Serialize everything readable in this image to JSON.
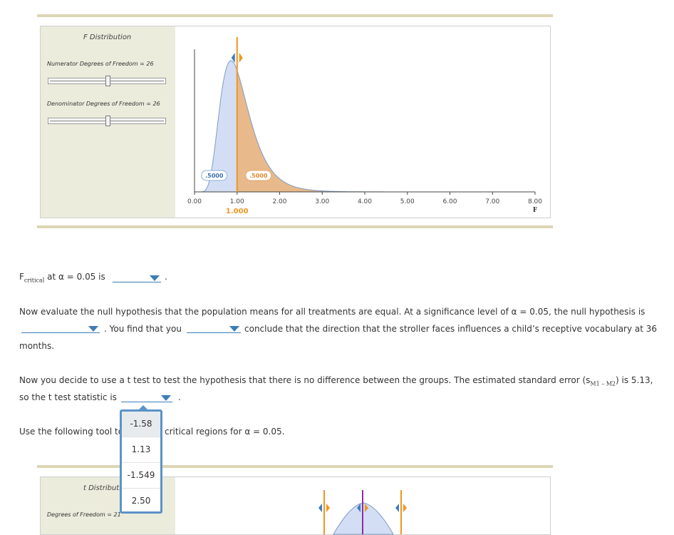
{
  "f_panel": {
    "title": "F Distribution",
    "numerator_label": "Numerator Degrees of Freedom = 26",
    "numerator_value": 26,
    "denominator_label": "Denominator Degrees of Freedom = 26",
    "denominator_value": 26,
    "slider_fraction_numerator": 0.5,
    "slider_fraction_denominator": 0.5
  },
  "chart_data": {
    "type": "area",
    "title": "",
    "xlabel": "F",
    "ylabel": "",
    "xlim": [
      0,
      8
    ],
    "x_ticks": [
      "0.00",
      "1.00",
      "2.00",
      "3.00",
      "4.00",
      "5.00",
      "6.00",
      "7.00",
      "8.00"
    ],
    "df_numerator": 26,
    "df_denominator": 26,
    "cutoff": 1.0,
    "cutoff_label": "1.000",
    "left_area_label": ".5000",
    "right_area_label": ".5000",
    "left_fill": "#d3def5",
    "right_fill": "#e8b98a",
    "cutoff_color": "#f0961e"
  },
  "q1": {
    "prefix_main": "F",
    "prefix_sub": "critical",
    "text": " at α = 0.05 is",
    "period": "."
  },
  "q2": {
    "line1": "Now evaluate the null hypothesis that the population means for all treatments are equal. At a significance level of α = 0.05, the null hypothesis is",
    "mid": ". You find that you",
    "end": "conclude that the direction that the stroller faces influences a child’s receptive vocabulary at 36",
    "line3": "months."
  },
  "q3": {
    "line1_pre": "Now you decide to use a t test to test the hypothesis that there is no difference between the groups. The estimated standard error (s",
    "sub": "M1 – M2",
    "line1_post": ") is 5.13,",
    "line2": "so the t test statistic is",
    "period": "."
  },
  "q4": {
    "pre": "Use the following tool to",
    "post": "critical regions for α = 0.05."
  },
  "dropdown_options": [
    "-1.58",
    "1.13",
    "-1.549",
    "2.50"
  ],
  "t_panel": {
    "title": "t Distribution",
    "df_label": "Degrees of Freedom = 21"
  }
}
